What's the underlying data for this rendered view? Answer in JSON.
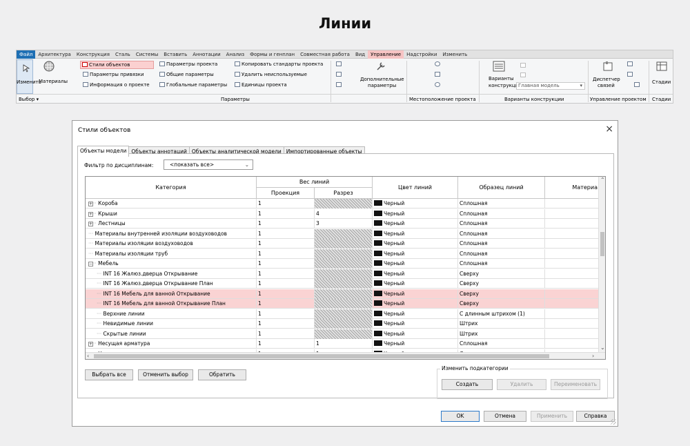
{
  "heading": "Линии",
  "ribbon": {
    "tabs": [
      "Файл",
      "Архитектура",
      "Конструкция",
      "Сталь",
      "Системы",
      "Вставить",
      "Аннотации",
      "Анализ",
      "Формы и генплан",
      "Совместная работа",
      "Вид",
      "Управление",
      "Надстройки",
      "Изменить"
    ],
    "modify": "Изменить",
    "materials": "Материалы",
    "object_styles": "Стили объектов",
    "snaps": "Параметры привязки",
    "project_info": "Информация о проекте",
    "project_params": "Параметры проекта",
    "shared_params": "Общие параметры",
    "global_params": "Глобальные параметры",
    "transfer_standards": "Копировать стандарты проекта",
    "purge_unused": "Удалить неиспользуемые",
    "project_units": "Единицы проекта",
    "additional_settings_1": "Дополнительные",
    "additional_settings_2": "параметры",
    "design_options_1": "Варианты",
    "design_options_2": "конструкции",
    "main_model": "Главная модель",
    "manager_1": "Диспетчер",
    "manager_2": "связей",
    "phases": "Стадии",
    "group_select": "Выбор",
    "group_settings": "Параметры",
    "group_location": "Местоположение проекта",
    "group_design_options": "Варианты конструкции",
    "group_manage_project": "Управление проектом",
    "group_phasing": "Стадии"
  },
  "dialog": {
    "title": "Стили объектов",
    "close": "×",
    "tabs": [
      "Объекты модели",
      "Объекты аннотаций",
      "Объекты аналитической модели",
      "Импортированные объекты"
    ],
    "filter_label": "Фильтр по дисциплинам:",
    "filter_value": "<показать все>",
    "columns": {
      "category": "Категория",
      "weight": "Вес линий",
      "projection": "Проекция",
      "cut": "Разрез",
      "color": "Цвет линий",
      "pattern": "Образец линий",
      "material": "Материа"
    },
    "rows": [
      {
        "indent": 0,
        "exp": "+",
        "name": "Короба",
        "proj": "1",
        "cut": "",
        "hatch": true,
        "color": "Черный",
        "pattern": "Сплошная",
        "sel": false
      },
      {
        "indent": 0,
        "exp": "+",
        "name": "Крыши",
        "proj": "1",
        "cut": "4",
        "hatch": false,
        "color": "Черный",
        "pattern": "Сплошная",
        "sel": false
      },
      {
        "indent": 0,
        "exp": "+",
        "name": "Лестницы",
        "proj": "1",
        "cut": "3",
        "hatch": false,
        "color": "Черный",
        "pattern": "Сплошная",
        "sel": false
      },
      {
        "indent": 0,
        "exp": "",
        "name": "Материалы внутренней изоляции воздуховодов",
        "proj": "1",
        "cut": "",
        "hatch": true,
        "color": "Черный",
        "pattern": "Сплошная",
        "sel": false
      },
      {
        "indent": 0,
        "exp": "",
        "name": "Материалы изоляции воздуховодов",
        "proj": "1",
        "cut": "",
        "hatch": true,
        "color": "Черный",
        "pattern": "Сплошная",
        "sel": false
      },
      {
        "indent": 0,
        "exp": "",
        "name": "Материалы изоляции труб",
        "proj": "1",
        "cut": "",
        "hatch": true,
        "color": "Черный",
        "pattern": "Сплошная",
        "sel": false
      },
      {
        "indent": 0,
        "exp": "−",
        "name": "Мебель",
        "proj": "1",
        "cut": "",
        "hatch": true,
        "color": "Черный",
        "pattern": "Сплошная",
        "sel": false
      },
      {
        "indent": 1,
        "exp": "",
        "name": "INT 16 Жалюз.дверца Открывание",
        "proj": "1",
        "cut": "",
        "hatch": true,
        "color": "Черный",
        "pattern": "Сверху",
        "sel": false
      },
      {
        "indent": 1,
        "exp": "",
        "name": "INT 16 Жалюз.дверца Открывание План",
        "proj": "1",
        "cut": "",
        "hatch": true,
        "color": "Черный",
        "pattern": "Сверху",
        "sel": false
      },
      {
        "indent": 1,
        "exp": "",
        "name": "INT 16 Мебель для ванной Открывание",
        "proj": "1",
        "cut": "",
        "hatch": true,
        "color": "Черный",
        "pattern": "Сверху",
        "sel": true
      },
      {
        "indent": 1,
        "exp": "",
        "name": "INT 16 Мебель для ванной Открывание План",
        "proj": "1",
        "cut": "",
        "hatch": true,
        "color": "Черный",
        "pattern": "Сверху",
        "sel": true
      },
      {
        "indent": 1,
        "exp": "",
        "name": "Верхние линии",
        "proj": "1",
        "cut": "",
        "hatch": true,
        "color": "Черный",
        "pattern": "С длинным штрихом (1)",
        "sel": false
      },
      {
        "indent": 1,
        "exp": "",
        "name": "Невидимые линии",
        "proj": "1",
        "cut": "",
        "hatch": true,
        "color": "Черный",
        "pattern": "Штрих",
        "sel": false
      },
      {
        "indent": 1,
        "exp": "",
        "name": "Скрытые линии",
        "proj": "1",
        "cut": "",
        "hatch": true,
        "color": "Черный",
        "pattern": "Штрих",
        "sel": false
      },
      {
        "indent": 0,
        "exp": "+",
        "name": "Несущая арматура",
        "proj": "1",
        "cut": "1",
        "hatch": false,
        "color": "Черный",
        "pattern": "Сплошная",
        "sel": false
      },
      {
        "indent": 0,
        "exp": "+",
        "name": "Несущие колонны",
        "proj": "1",
        "cut": "1",
        "hatch": false,
        "color": "Черный",
        "pattern": "Сплошная",
        "sel": false
      }
    ],
    "select_all": "Выбрать все",
    "select_none": "Отменить выбор",
    "invert": "Обратить",
    "modify_subcats": "Изменить подкатегории",
    "create": "Создать",
    "delete": "Удалить",
    "rename": "Переименовать",
    "ok": "OK",
    "cancel": "Отмена",
    "apply": "Применить",
    "help": "Справка"
  }
}
